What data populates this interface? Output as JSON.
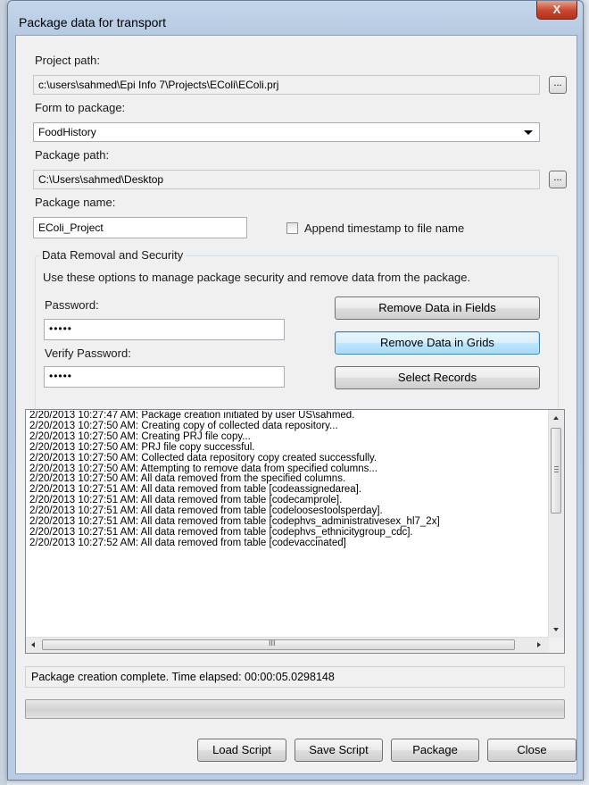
{
  "window": {
    "title": "Package data for transport",
    "close_glyph": "X"
  },
  "project": {
    "label": "Project path:",
    "value": "c:\\users\\sahmed\\Epi Info 7\\Projects\\EColi\\EColi.prj",
    "browse_label": "..."
  },
  "form": {
    "label": "Form to package:",
    "value": "FoodHistory"
  },
  "package_path": {
    "label": "Package path:",
    "value": "C:\\Users\\sahmed\\Desktop",
    "browse_label": "..."
  },
  "package_name": {
    "label": "Package name:",
    "value": "EColi_Project",
    "append_timestamp_label": "Append timestamp to file name",
    "append_timestamp_checked": false
  },
  "security": {
    "group_title": "Data Removal and Security",
    "description": "Use these options to manage package security and remove data from the package.",
    "password_label": "Password:",
    "password_value": "•••••",
    "verify_label": "Verify Password:",
    "verify_value": "•••••",
    "remove_fields_label": "Remove Data in Fields",
    "remove_grids_label": "Remove Data in Grids",
    "select_records_label": "Select Records"
  },
  "log": {
    "lines": [
      "2/20/2013 10:27:47 AM: Package creation initiated by user US\\sahmed.",
      "2/20/2013 10:27:50 AM: Creating copy of collected data repository...",
      "2/20/2013 10:27:50 AM: Creating PRJ file copy...",
      "2/20/2013 10:27:50 AM: PRJ file copy successful.",
      "2/20/2013 10:27:50 AM: Collected data repository copy created successfully.",
      "2/20/2013 10:27:50 AM: Attempting to remove data from specified columns...",
      "2/20/2013 10:27:50 AM: All data removed from the specified columns.",
      "2/20/2013 10:27:51 AM: All data removed from table [codeassignedarea].",
      "2/20/2013 10:27:51 AM: All data removed from table [codecamprole].",
      "2/20/2013 10:27:51 AM: All data removed from table [codeloosestoolsperday].",
      "2/20/2013 10:27:51 AM: All data removed from table [codephvs_administrativesex_hl7_2x]",
      "2/20/2013 10:27:51 AM: All data removed from table [codephvs_ethnicitygroup_cdc].",
      "2/20/2013 10:27:52 AM: All data removed from table [codevaccinated]"
    ],
    "scroll_grip_glyph": "III"
  },
  "status": {
    "text": "Package creation complete. Time elapsed: 00:00:05.0298148"
  },
  "progress": {
    "fraction": 0
  },
  "footer": {
    "load_script_label": "Load Script",
    "save_script_label": "Save Script",
    "package_label": "Package",
    "close_label": "Close"
  },
  "colors": {
    "title_bar": "#b9cce3",
    "close_button": "#c7462d",
    "dialog_bg": "#f0f0f0"
  }
}
